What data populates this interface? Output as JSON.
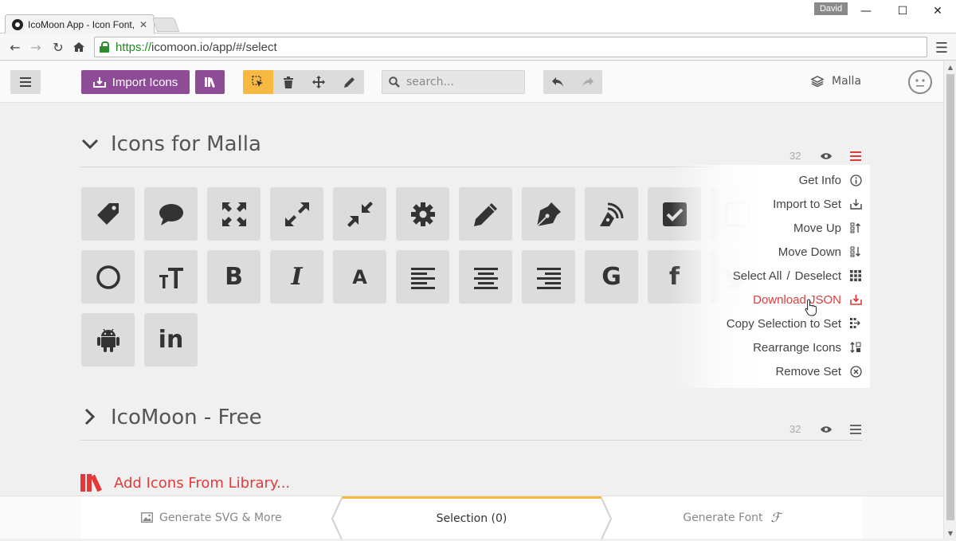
{
  "browser": {
    "tab_title": "IcoMoon App - Icon Font,",
    "user_badge": "David",
    "url_scheme": "https://",
    "url_rest": "icomoon.io/app/#/select"
  },
  "header": {
    "import_label": "Import Icons",
    "search_placeholder": "search...",
    "project_name": "Malla"
  },
  "sets": [
    {
      "title": "Icons for Malla",
      "count": "32",
      "expanded": true
    },
    {
      "title": "IcoMoon - Free",
      "count": "32",
      "expanded": false
    }
  ],
  "icons_row1": [
    "tag-icon",
    "bubble-icon",
    "enlarge-icon",
    "expand-icon",
    "shrink-icon",
    "cog-icon",
    "pencil-icon",
    "pen-icon",
    "feed-icon",
    "checkbox-checked-icon",
    "checkbox-unchecked-icon",
    "radio-icon"
  ],
  "icons_row2": [
    "circle-icon",
    "text-height-icon",
    "bold-icon",
    "italic-icon",
    "font-icon",
    "align-left-icon",
    "align-center-icon",
    "align-right-icon",
    "google-icon",
    "facebook-icon",
    "twitter-icon"
  ],
  "icons_row3": [
    "android-icon",
    "linkedin-icon"
  ],
  "glyphs": {
    "text_height": "T",
    "bold": "B",
    "italic": "I",
    "font": "A",
    "google": "G",
    "facebook": "f",
    "linkedin": "in"
  },
  "menu": [
    {
      "label": "Get Info",
      "icon": "info-icon"
    },
    {
      "label": "Import to Set",
      "icon": "import-icon"
    },
    {
      "label": "Move Up",
      "icon": "move-up-icon"
    },
    {
      "label": "Move Down",
      "icon": "move-down-icon"
    },
    {
      "label": "Select All",
      "label2": "Deselect",
      "icon": "grid-icon"
    },
    {
      "label": "Download JSON",
      "icon": "download-icon",
      "highlight": "#e03a3a"
    },
    {
      "label": "Copy Selection to Set",
      "icon": "copy-selection-icon"
    },
    {
      "label": "Rearrange Icons",
      "icon": "rearrange-icon"
    },
    {
      "label": "Remove Set",
      "icon": "remove-icon"
    }
  ],
  "menu_separator": "/",
  "add_library": "Add Icons From Library...",
  "footer": {
    "generate_svg": "Generate SVG & More",
    "selection": "Selection (0)",
    "generate_font": "Generate Font"
  },
  "colors": {
    "accent_purple": "#8e4b96",
    "accent_yellow": "#f7b942",
    "accent_red": "#e03a3a"
  }
}
